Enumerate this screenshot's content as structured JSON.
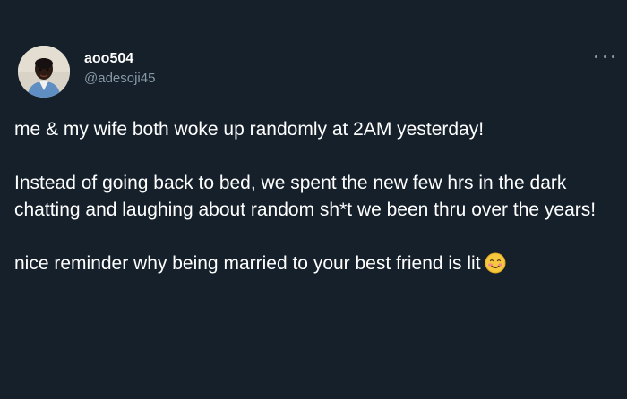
{
  "tweet": {
    "author": {
      "display_name": "aoo504",
      "handle": "@adesoji45",
      "avatar_icon": "profile-photo"
    },
    "more_icon": "more-horizontal-icon",
    "paragraphs": [
      "me & my wife both woke up randomly at 2AM yesterday!",
      "Instead of going back to bed, we spent the new few hrs in the dark chatting and laughing about random sh*t we been thru over the years!",
      "nice reminder why being married to your best friend is lit"
    ],
    "emoji_icon": "smiling-face-with-blush-emoji"
  },
  "colors": {
    "background": "#15202b",
    "text_primary": "#ffffff",
    "text_secondary": "#8899a6"
  }
}
